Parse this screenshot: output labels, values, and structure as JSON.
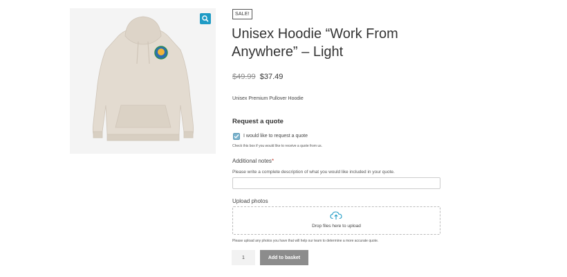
{
  "product": {
    "sale_badge": "SALE!",
    "title": "Unisex Hoodie “Work From Anywhere” – Light",
    "price_old": "$49.99",
    "price_new": "$37.49",
    "short_description": "Unisex Premium Pullover Hoodie",
    "image_alt": "Light unisex hoodie with globe logo",
    "zoom_icon": "magnifier-icon"
  },
  "quote": {
    "heading": "Request a quote",
    "checkbox_label": "I would like to request a quote",
    "checkbox_checked": true,
    "checkbox_help": "Check this box if you would like to receive a quote from us.",
    "notes_label": "Additional notes",
    "notes_required_mark": "*",
    "notes_help": "Please write a complete description of what you would like included in your quote.",
    "notes_value": "",
    "upload_label": "Upload photos",
    "upload_icon": "cloud-upload-icon",
    "drop_text": "Drop files here to upload",
    "upload_help": "Please upload any photos you have that will help our team to determine a more accurate quote."
  },
  "cart": {
    "quantity": "1",
    "add_label": "Add to basket"
  },
  "colors": {
    "accent": "#1f9bc5",
    "checkbox": "#7ab2cc",
    "button": "#8c8c8c",
    "hoodie": "#e3dbd0"
  }
}
